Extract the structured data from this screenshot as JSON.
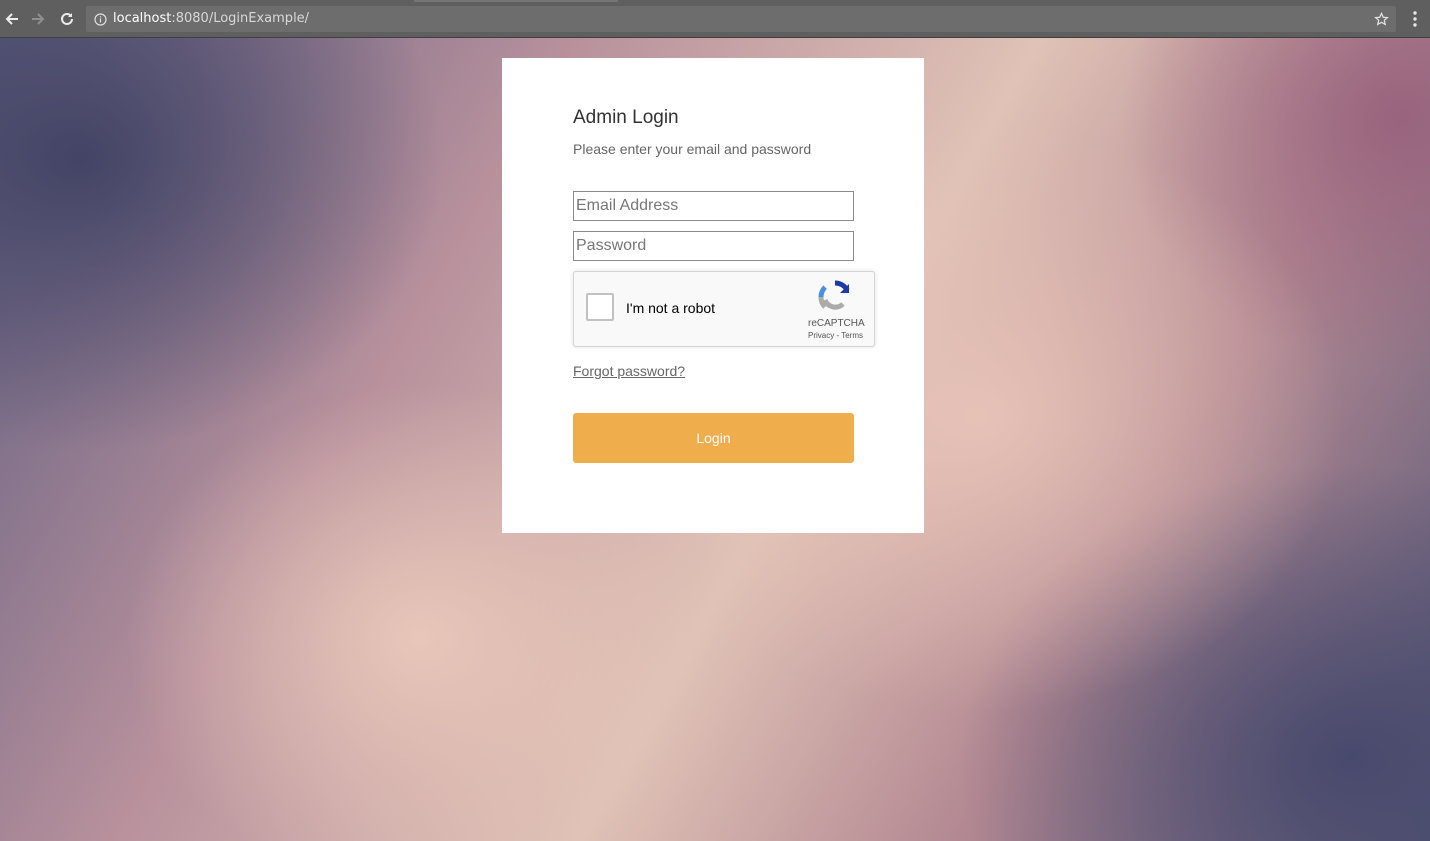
{
  "browser": {
    "url_host": "localhost",
    "url_rest": ":8080/LoginExample/",
    "icons": {
      "back": "back-arrow-icon",
      "forward": "forward-arrow-icon",
      "reload": "reload-icon",
      "info": "info-icon",
      "star": "star-icon",
      "menu": "menu-icon"
    }
  },
  "login": {
    "title": "Admin Login",
    "subtitle": "Please enter your email and password",
    "email_placeholder": "Email Address",
    "password_placeholder": "Password",
    "recaptcha": {
      "label": "I'm not a robot",
      "brand": "reCAPTCHA",
      "privacy": "Privacy",
      "separator": " - ",
      "terms": "Terms"
    },
    "forgot_password": "Forgot password?",
    "login_button": "Login"
  },
  "colors": {
    "login_button": "#efad4c",
    "card_background": "#ffffff",
    "browser_bar": "#5f5f5f"
  }
}
